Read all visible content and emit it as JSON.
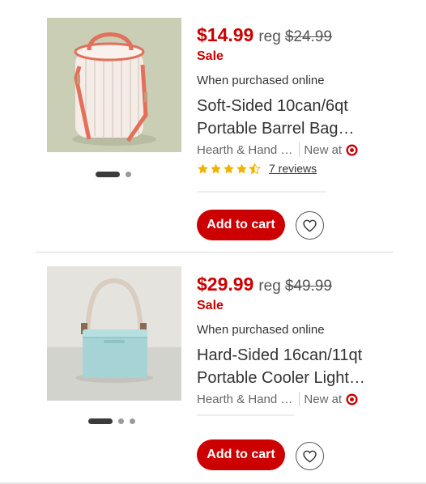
{
  "products": [
    {
      "price": "$14.99",
      "reg_label": "reg",
      "reg_price": "$24.99",
      "sale_label": "Sale",
      "purchase_note": "When purchased online",
      "title_line1": "Soft-Sided 10can/6qt",
      "title_line2": "Portable Barrel Bag…",
      "brand": "Hearth & Hand …",
      "availability": "New at",
      "rating": 4.5,
      "reviews": "7 reviews",
      "add_to_cart": "Add to cart",
      "image": "soft-sided barrel cooler bag",
      "image_slides": 2,
      "active_slide": 1
    },
    {
      "price": "$29.99",
      "reg_label": "reg",
      "reg_price": "$49.99",
      "sale_label": "Sale",
      "purchase_note": "When purchased online",
      "title_line1": "Hard-Sided 16can/11qt",
      "title_line2": "Portable Cooler Light…",
      "brand": "Hearth & Hand …",
      "availability": "New at",
      "add_to_cart": "Add to cart",
      "image": "hard-sided mint cooler",
      "image_slides": 3,
      "active_slide": 1
    }
  ],
  "icons": {
    "store": "target-bullseye-icon",
    "favorite": "heart-outline-icon",
    "rating": "star-icon"
  },
  "colors": {
    "accent_red": "#cc0000",
    "star_gold": "#f0b400",
    "text_primary": "#333333"
  }
}
